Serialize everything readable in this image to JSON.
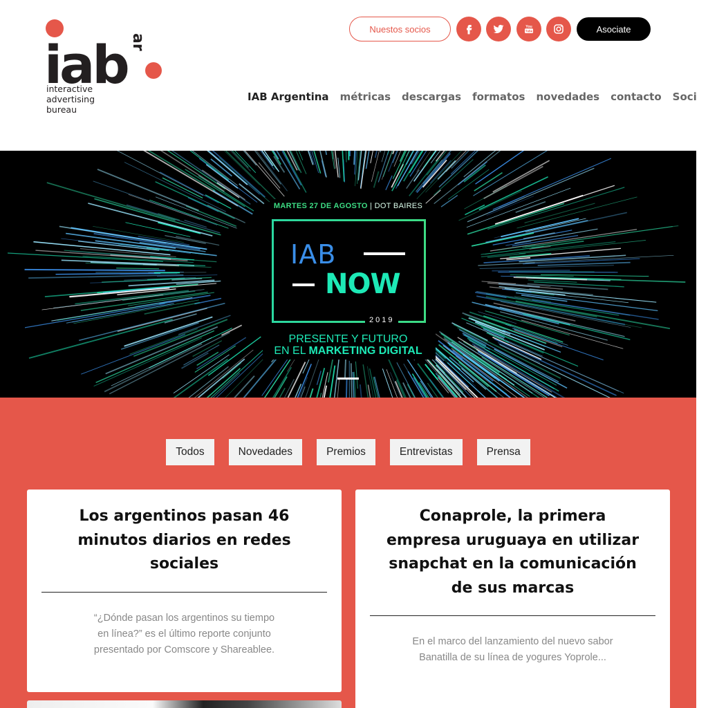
{
  "logo": {
    "word": "iab",
    "suffix": "ar",
    "tagline_lines": [
      "interactive",
      "advertising",
      "bureau"
    ]
  },
  "header": {
    "partners_button": "Nuestos socios",
    "join_button": "Asociate",
    "social": [
      {
        "name": "facebook",
        "glyph": "f"
      },
      {
        "name": "twitter",
        "glyph": "t"
      },
      {
        "name": "youtube",
        "glyph": "You Tube"
      },
      {
        "name": "instagram",
        "glyph": "ig"
      }
    ]
  },
  "nav": {
    "items": [
      "IAB Argentina",
      "métricas",
      "descargas",
      "formatos",
      "novedades",
      "contacto",
      "Socios"
    ],
    "active_index": 0
  },
  "banner": {
    "date": "MARTES 27 DE AGOSTO",
    "venue": "DOT BAIRES",
    "title_part1": "IAB",
    "title_part2": "NOW",
    "year": "2019",
    "subtitle_line1": "PRESENTE Y FUTURO",
    "subtitle_line2_prefix": "EN EL ",
    "subtitle_line2_bold": "MARKETING DIGITAL"
  },
  "filters": [
    "Todos",
    "Novedades",
    "Premios",
    "Entrevistas",
    "Prensa"
  ],
  "cards": [
    {
      "title": "Los argentinos pasan 46 minutos diarios en redes sociales",
      "excerpt": "“¿Dónde pasan los argentinos su tiempo en línea?” es el último reporte conjunto presentado por Comscore y Shareablee."
    },
    {
      "title": "Conaprole, la primera empresa uruguaya en utilizar snapchat en la comunicación de sus marcas",
      "excerpt": "En el marco del lanzamiento del nuevo sabor Banatilla de su línea de yogures Yoprole..."
    }
  ],
  "colors": {
    "brand_red": "#e5574a",
    "banner_green": "#1de9b6",
    "banner_blue": "#3a8ee8"
  }
}
